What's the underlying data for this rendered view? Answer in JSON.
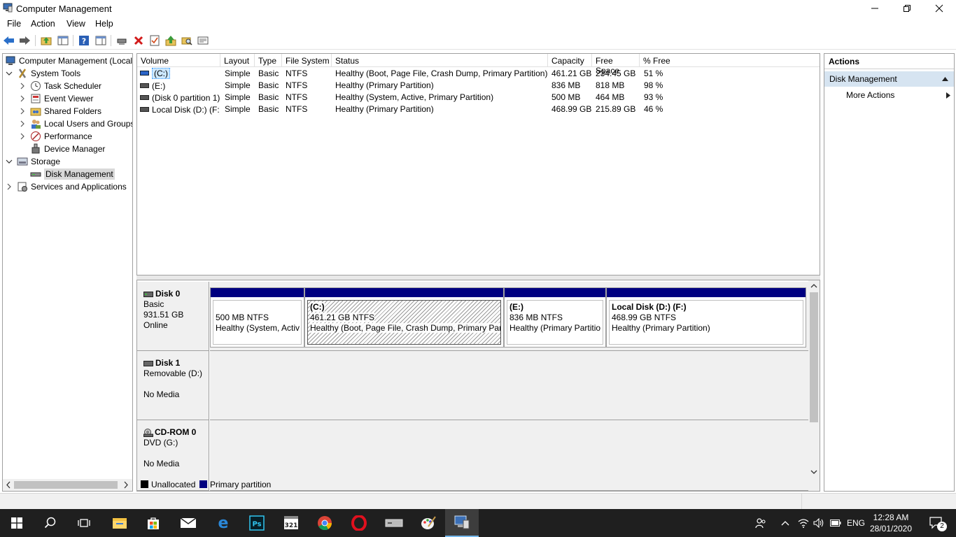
{
  "window": {
    "title": "Computer Management"
  },
  "menu": [
    "File",
    "Action",
    "View",
    "Help"
  ],
  "tree": {
    "root": "Computer Management (Local",
    "system_tools": "System Tools",
    "task_scheduler": "Task Scheduler",
    "event_viewer": "Event Viewer",
    "shared_folders": "Shared Folders",
    "local_users": "Local Users and Groups",
    "performance": "Performance",
    "device_manager": "Device Manager",
    "storage": "Storage",
    "disk_management": "Disk Management",
    "services": "Services and Applications"
  },
  "volumes": {
    "columns": [
      "Volume",
      "Layout",
      "Type",
      "File System",
      "Status",
      "Capacity",
      "Free Space",
      "% Free"
    ],
    "rows": [
      {
        "volume": "(C:)",
        "layout": "Simple",
        "type": "Basic",
        "fs": "NTFS",
        "status": "Healthy (Boot, Page File, Crash Dump, Primary Partition)",
        "capacity": "461.21 GB",
        "free": "234.45 GB",
        "pct": "51 %"
      },
      {
        "volume": "(E:)",
        "layout": "Simple",
        "type": "Basic",
        "fs": "NTFS",
        "status": "Healthy (Primary Partition)",
        "capacity": "836 MB",
        "free": "818 MB",
        "pct": "98 %"
      },
      {
        "volume": "(Disk 0 partition 1)",
        "layout": "Simple",
        "type": "Basic",
        "fs": "NTFS",
        "status": "Healthy (System, Active, Primary Partition)",
        "capacity": "500 MB",
        "free": "464 MB",
        "pct": "93 %"
      },
      {
        "volume": "Local Disk (D:) (F:)",
        "layout": "Simple",
        "type": "Basic",
        "fs": "NTFS",
        "status": "Healthy (Primary Partition)",
        "capacity": "468.99 GB",
        "free": "215.89 GB",
        "pct": "46 %"
      }
    ]
  },
  "disks": {
    "disk0": {
      "name": "Disk 0",
      "kind": "Basic",
      "size": "931.51 GB",
      "state": "Online",
      "partitions": [
        {
          "title": "",
          "size": "500 MB NTFS",
          "status": "Healthy (System, Activ"
        },
        {
          "title": "(C:)",
          "size": "461.21 GB NTFS",
          "status": "Healthy (Boot, Page File, Crash Dump, Primary Part"
        },
        {
          "title": "(E:)",
          "size": "836 MB NTFS",
          "status": "Healthy (Primary Partitio"
        },
        {
          "title": "Local Disk (D:)  (F:)",
          "size": "468.99 GB NTFS",
          "status": "Healthy (Primary Partition)"
        }
      ]
    },
    "disk1": {
      "name": "Disk 1",
      "kind": "Removable (D:)",
      "state": "No Media"
    },
    "cdrom0": {
      "name": "CD-ROM 0",
      "kind": "DVD (G:)",
      "state": "No Media"
    }
  },
  "legend": {
    "unallocated": "Unallocated",
    "primary": "Primary partition",
    "unallocated_color": "#000000",
    "primary_color": "#000080"
  },
  "actions": {
    "header": "Actions",
    "section": "Disk Management",
    "more": "More Actions"
  },
  "taskbar": {
    "lang": "ENG",
    "time": "12:28 AM",
    "date": "28/01/2020",
    "notifications": "2"
  }
}
